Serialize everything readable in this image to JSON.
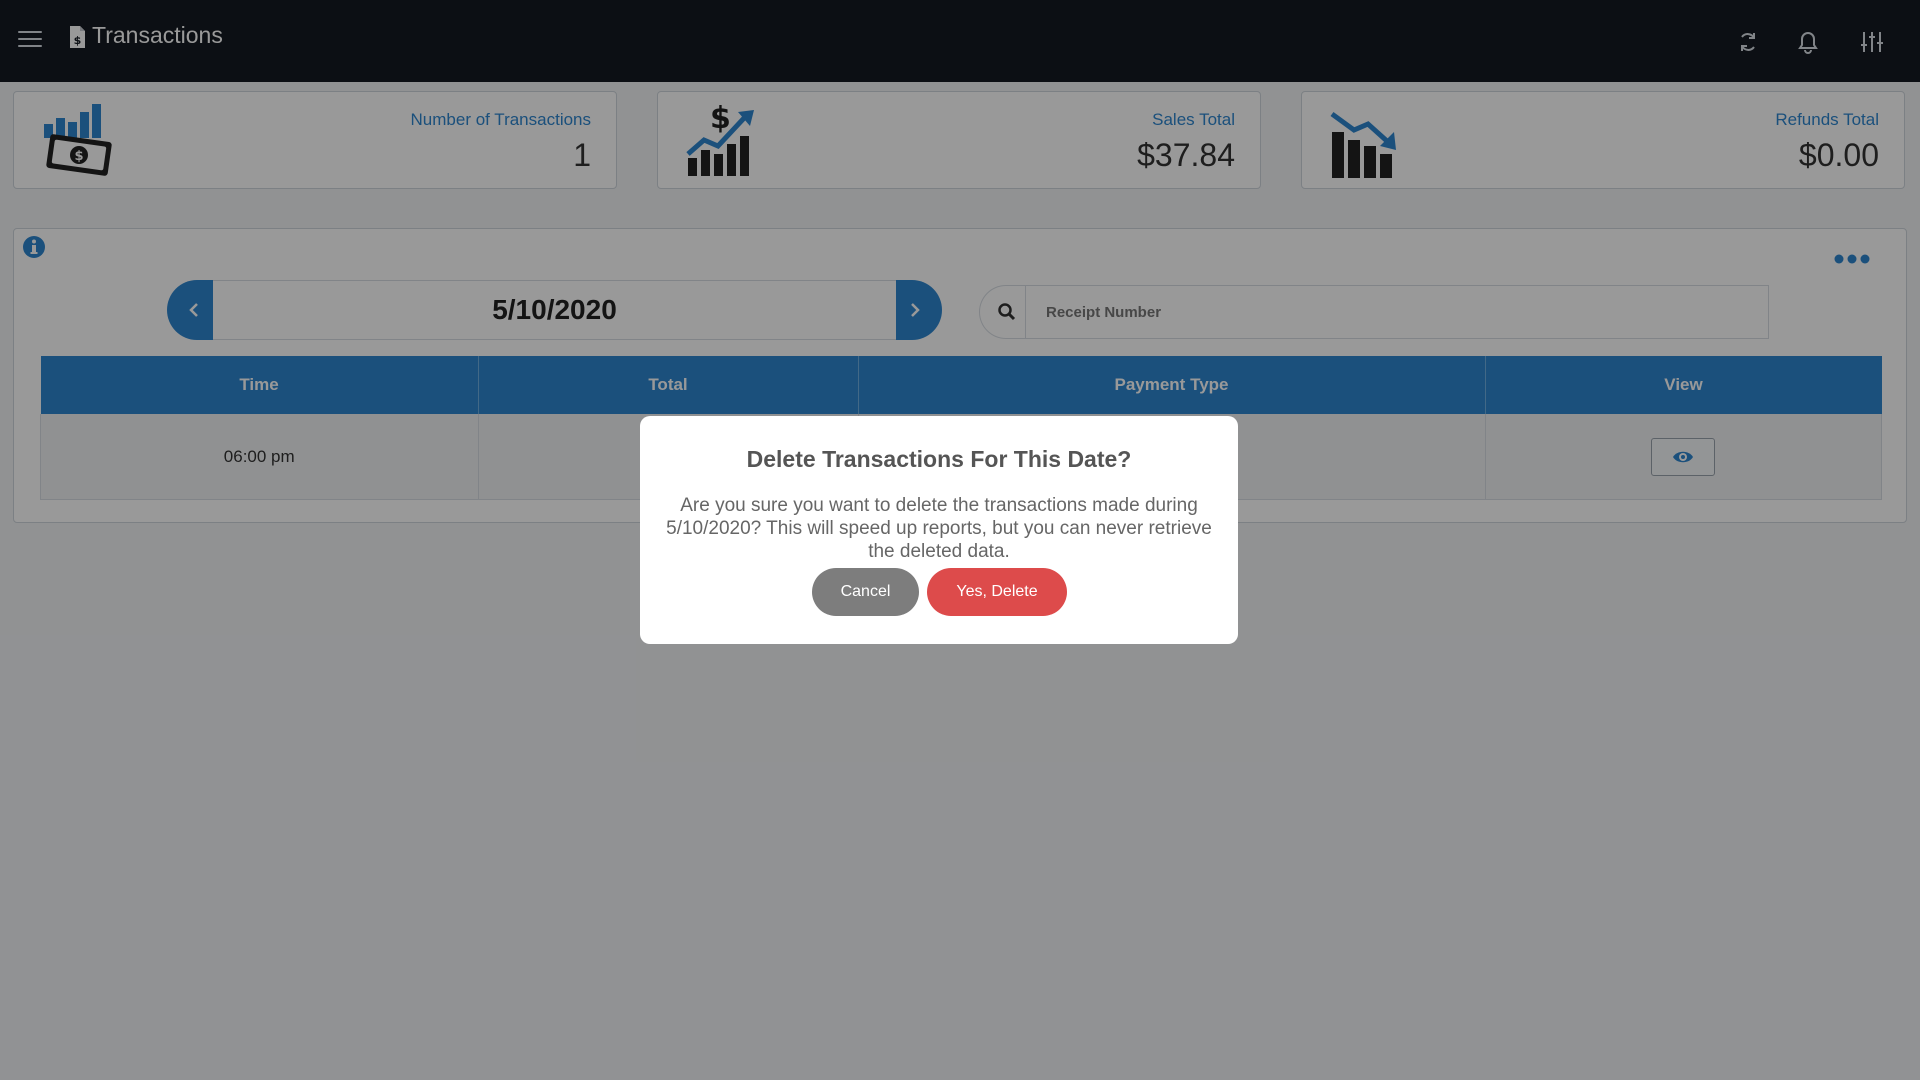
{
  "header": {
    "title": "Transactions",
    "icons": [
      "menu-icon",
      "receipt-icon",
      "refresh-icon",
      "bell-icon",
      "sliders-icon"
    ]
  },
  "stats": [
    {
      "label": "Number of Transactions",
      "value": "1",
      "icon": "cash-chart-icon"
    },
    {
      "label": "Sales Total",
      "value": "$37.84",
      "icon": "sales-up-chart-icon"
    },
    {
      "label": "Refunds Total",
      "value": "$0.00",
      "icon": "refunds-down-chart-icon"
    }
  ],
  "date_nav": {
    "date": "5/10/2020"
  },
  "search": {
    "placeholder": "Receipt Number"
  },
  "table": {
    "columns": [
      "Time",
      "Total",
      "Payment Type",
      "View"
    ],
    "rows": [
      {
        "time": "06:00 pm",
        "total": "",
        "payment_type": ""
      }
    ]
  },
  "dialog": {
    "title": "Delete Transactions For This Date?",
    "message": "Are you sure you want to delete the transactions made during 5/10/2020? This will speed up reports, but you can never retrieve the deleted data.",
    "cancel_label": "Cancel",
    "confirm_label": "Yes, Delete"
  },
  "colors": {
    "topbar": "#141a22",
    "accent": "#2e86cf",
    "danger": "#dd4b4b",
    "neutral_button": "#7d7d7d"
  }
}
